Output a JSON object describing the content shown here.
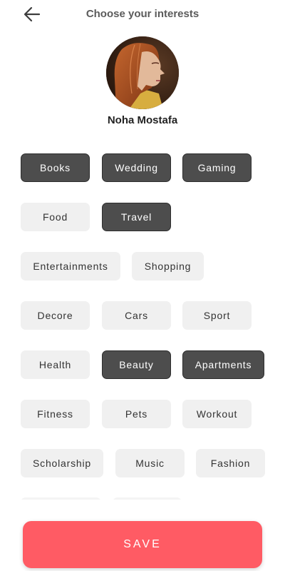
{
  "header": {
    "title": "Choose your interests",
    "back_icon": "arrow-left-icon"
  },
  "profile": {
    "name": "Noha Mostafa"
  },
  "colors": {
    "chip_selected": "#4d4d4d",
    "chip_unselected": "#f0f0f0",
    "save_button": "#ff5b64"
  },
  "interests": [
    {
      "label": "Books",
      "selected": true
    },
    {
      "label": "Wedding",
      "selected": true
    },
    {
      "label": "Gaming",
      "selected": true
    },
    {
      "label": "Food",
      "selected": false
    },
    {
      "label": "Travel",
      "selected": true
    },
    {
      "label": "Entertainments",
      "selected": false
    },
    {
      "label": "Shopping",
      "selected": false
    },
    {
      "label": "Decore",
      "selected": false
    },
    {
      "label": "Cars",
      "selected": false
    },
    {
      "label": "Sport",
      "selected": false
    },
    {
      "label": "Health",
      "selected": false
    },
    {
      "label": "Beauty",
      "selected": true
    },
    {
      "label": "Apartments",
      "selected": true
    },
    {
      "label": "Fitness",
      "selected": false
    },
    {
      "label": "Pets",
      "selected": false
    },
    {
      "label": "Workout",
      "selected": false
    },
    {
      "label": "Scholarship",
      "selected": false
    },
    {
      "label": "Music",
      "selected": false
    },
    {
      "label": "Fashion",
      "selected": false
    }
  ],
  "save_button": {
    "label": "SAVE"
  }
}
